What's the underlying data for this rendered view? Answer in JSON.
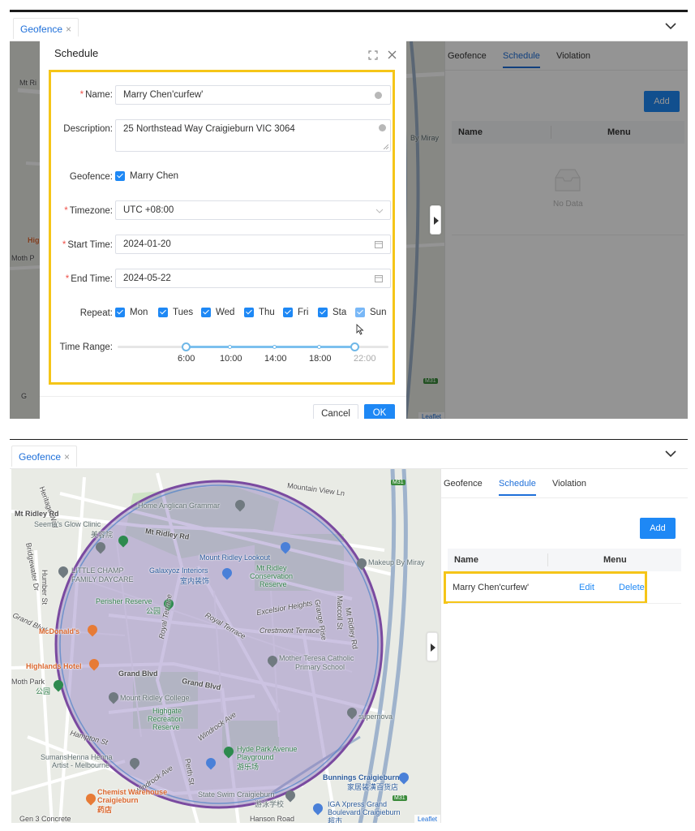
{
  "screen1": {
    "tab": {
      "label": "Geofence",
      "close": "×"
    },
    "panel": {
      "tabs": [
        {
          "label": "Geofence"
        },
        {
          "label": "Schedule"
        },
        {
          "label": "Violation"
        }
      ],
      "add_label": "Add",
      "columns": {
        "name": "Name",
        "menu": "Menu"
      },
      "empty_text": "No Data"
    },
    "map_labels": {
      "mt_ridley": "Mt Ri",
      "makeup": "By Miray",
      "hig": "Hig",
      "moth": "Moth P",
      "leaflet": "Leaflet",
      "g": "G",
      "m31": "M31"
    },
    "modal": {
      "title": "Schedule",
      "name": {
        "label": "Name",
        "value": "Marry Chen'curfew'"
      },
      "description": {
        "label": "Description",
        "value": "25 Northstead Way Craigieburn VIC 3064"
      },
      "geofence": {
        "label": "Geofence",
        "option": "Marry Chen",
        "checked": true
      },
      "timezone": {
        "label": "Timezone",
        "value": "UTC +08:00"
      },
      "start_time": {
        "label": "Start Time",
        "value": "2024-01-20"
      },
      "end_time": {
        "label": "End Time",
        "value": "2024-05-22"
      },
      "repeat": {
        "label": "Repeat",
        "days": [
          {
            "label": "Mon",
            "checked": true
          },
          {
            "label": "Tues",
            "checked": true
          },
          {
            "label": "Wed",
            "checked": true
          },
          {
            "label": "Thu",
            "checked": true
          },
          {
            "label": "Fri",
            "checked": true
          },
          {
            "label": "Sta",
            "checked": true
          },
          {
            "label": "Sun",
            "checked": true
          }
        ]
      },
      "time_range": {
        "label": "Time Range",
        "ticks": [
          "6:00",
          "10:00",
          "14:00",
          "18:00",
          "22:00"
        ],
        "start": "6:00",
        "end": "22:00"
      },
      "cancel_label": "Cancel",
      "ok_label": "OK"
    }
  },
  "screen2": {
    "tab": {
      "label": "Geofence",
      "close": "×"
    },
    "panel": {
      "tabs": [
        {
          "label": "Geofence"
        },
        {
          "label": "Schedule"
        },
        {
          "label": "Violation"
        }
      ],
      "add_label": "Add",
      "columns": {
        "name": "Name",
        "menu": "Menu"
      },
      "rows": [
        {
          "name": "Marry Chen'curfew'",
          "edit": "Edit",
          "delete": "Delete"
        }
      ]
    },
    "map_labels": {
      "heritage_way": "Heritage Way",
      "mountain_view": "Mountain View Ln",
      "m31_top": "M31",
      "mt_ridley_rd_left": "Mt Ridley Rd",
      "seemas": "Seema's Glow Clinic",
      "seemas_cn": "美容院",
      "home_anglican": "Home Anglican Grammar",
      "mt_ridley_rd_mid": "Mt Ridley Rd",
      "lookout": "Mount Ridley Lookout",
      "little_champ": "LITTLE CHAMP",
      "family_daycare": "FAMILY DAYCARE",
      "galaxyoz": "Galaxyoz Interiors",
      "galaxyoz_cn": "室内装饰",
      "conservation1": "Mt Ridley",
      "conservation2": "Conservation",
      "conservation3": "Reserve",
      "makeup": "Makeup By Miray",
      "mt_ridley_rd_right": "Mt Ridley Rd",
      "bridgewater": "Bridgewater Dr",
      "humber": "Humber St",
      "perisher": "Perisher Reserve",
      "perisher_cn": "公园",
      "excelsior": "Excelsior Heights",
      "grange": "Grange Rise",
      "maccoll": "Maccoll St",
      "royal_terrace": "Royal Terrace",
      "crestmont": "Crestmont Terrace",
      "grand_blvd_left": "Grand Blvd",
      "mcdonalds": "McDonald's",
      "highlands": "Highlands Hotel",
      "mother_teresa1": "Mother Teresa Catholic",
      "mother_teresa2": "Primary School",
      "royal_terrace2": "Royal Terrace",
      "grand_blvd_mid": "Grand Blvd",
      "grand_blvd_right": "Grand Blvd",
      "moth_park": "Moth Park",
      "moth_park_cn": "公园",
      "mount_ridley_college": "Mount Ridley College",
      "highgate1": "Highgate",
      "highgate2": "Recreation",
      "highgate3": "Reserve",
      "supernova": "supernova",
      "windrock_ave": "Windrock Ave",
      "hampton": "Hampton St",
      "sumans1": "SumansHenna Henna",
      "sumans2": "Artist - Melbourne",
      "hyde1": "Hyde Park Avenue",
      "hyde2": "Playground",
      "hyde_cn": "游乐场",
      "windrock_ave2": "Windrock Ave",
      "perth": "Perth St",
      "bunnings1": "Bunnings Craigieburn",
      "bunnings_cn": "家居装潢百货店",
      "chemist1": "Chemist Warehouse",
      "chemist2": "Craigieburn",
      "chemist_cn": "药店",
      "state_swim": "State Swim Craigieburn",
      "state_swim_cn": "游泳学校",
      "iga1": "IGA Xpress Grand",
      "iga2": "Boulevard Craigieburn",
      "iga_cn": "超市",
      "gen3": "Gen 3 Concrete",
      "hanson": "Hanson Road",
      "m31_bottom": "M31",
      "leaflet": "Leaflet"
    }
  },
  "colors": {
    "accent": "#1e88f5",
    "highlight": "#f5c518",
    "geofence_fill": "#8e7bbf",
    "geofence_stroke": "#7a4aa0"
  }
}
